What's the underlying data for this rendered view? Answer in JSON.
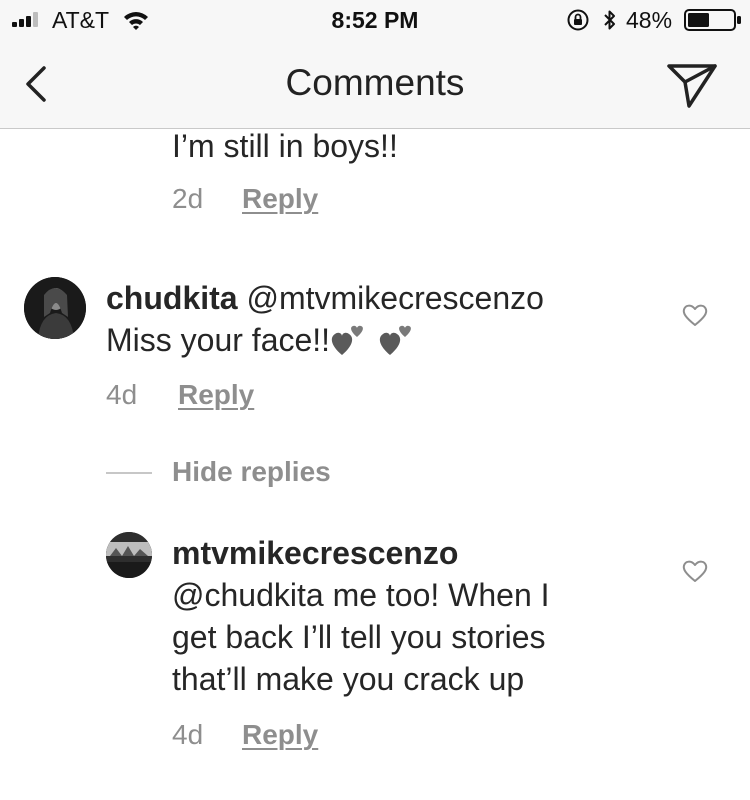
{
  "status_bar": {
    "carrier": "AT&T",
    "time": "8:52 PM",
    "battery_percent": "48%",
    "battery_level": 0.48,
    "signal_bars": 3
  },
  "nav": {
    "title": "Comments",
    "back_icon": "chevron-left-icon",
    "send_icon": "paper-plane-icon"
  },
  "comments": [
    {
      "text": "I’m still in boys!!",
      "time": "2d",
      "reply_label": "Reply"
    },
    {
      "username": "chudkita",
      "mention": "@mtvmikecrescenzo",
      "text": "Miss your face!!",
      "emoji": [
        "grey-heart-sparkle",
        "grey-heart-sparkle"
      ],
      "time": "4d",
      "reply_label": "Reply"
    }
  ],
  "hide_replies_label": "Hide replies",
  "reply": {
    "username": "mtvmikecrescenzo",
    "lines": [
      "@chudkita me too! When I",
      "get back I’ll tell you stories",
      "that’ll make you crack up"
    ],
    "time": "4d",
    "reply_label": "Reply"
  },
  "colors": {
    "text": "#262626",
    "meta": "#8e8e8e",
    "bar_bg": "#f7f7f7"
  }
}
